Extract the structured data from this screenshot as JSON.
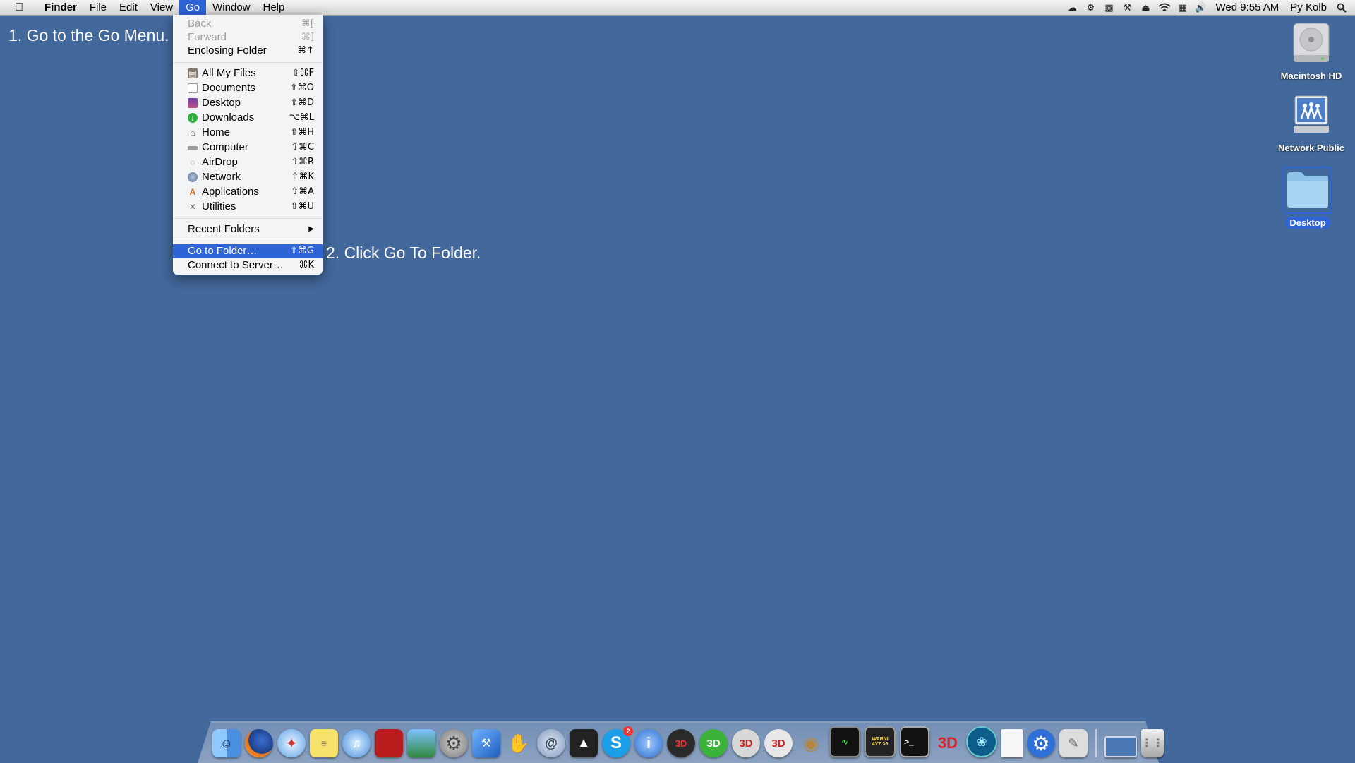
{
  "menubar": {
    "apple_icon": "apple-logo-icon",
    "app_name": "Finder",
    "menus": [
      "File",
      "Edit",
      "View",
      "Go",
      "Window",
      "Help"
    ],
    "active_menu": "Go"
  },
  "status": {
    "icons": [
      "cloud-app-icon",
      "gear-app-icon",
      "pc-app-icon",
      "tools-icon",
      "eject-icon",
      "wifi-icon",
      "input-menu-icon",
      "volume-icon"
    ],
    "datetime": "Wed 9:55 AM",
    "user": "Py Kolb",
    "search_icon": "spotlight-icon"
  },
  "go_menu": {
    "back": {
      "label": "Back",
      "shortcut": "⌘["
    },
    "forward": {
      "label": "Forward",
      "shortcut": "⌘]"
    },
    "enclosing": {
      "label": "Enclosing Folder",
      "shortcut": "⌘↑"
    },
    "places": [
      {
        "label": "All My Files",
        "shortcut": "⇧⌘F",
        "icon": "all-files-icon"
      },
      {
        "label": "Documents",
        "shortcut": "⇧⌘O",
        "icon": "documents-icon"
      },
      {
        "label": "Desktop",
        "shortcut": "⇧⌘D",
        "icon": "desktop-icon"
      },
      {
        "label": "Downloads",
        "shortcut": "⌥⌘L",
        "icon": "downloads-icon"
      },
      {
        "label": "Home",
        "shortcut": "⇧⌘H",
        "icon": "home-icon"
      },
      {
        "label": "Computer",
        "shortcut": "⇧⌘C",
        "icon": "computer-icon"
      },
      {
        "label": "AirDrop",
        "shortcut": "⇧⌘R",
        "icon": "airdrop-icon"
      },
      {
        "label": "Network",
        "shortcut": "⇧⌘K",
        "icon": "network-icon"
      },
      {
        "label": "Applications",
        "shortcut": "⇧⌘A",
        "icon": "applications-icon"
      },
      {
        "label": "Utilities",
        "shortcut": "⇧⌘U",
        "icon": "utilities-icon"
      }
    ],
    "recent": {
      "label": "Recent Folders",
      "arrow": "▶"
    },
    "goto": {
      "label": "Go to Folder…",
      "shortcut": "⇧⌘G"
    },
    "connect": {
      "label": "Connect to Server…",
      "shortcut": "⌘K"
    }
  },
  "annotations": {
    "step1": "1. Go to the Go Menu.",
    "step2": "2. Click Go To Folder."
  },
  "desktop_icons": [
    {
      "label": "Macintosh HD",
      "icon": "hard-drive-icon"
    },
    {
      "label": "Network Public",
      "icon": "network-share-icon"
    },
    {
      "label": "Desktop",
      "icon": "folder-icon",
      "selected": true
    }
  ],
  "dock": {
    "items": [
      "finder-icon",
      "firefox-icon",
      "safari-icon",
      "stickies-icon",
      "itunes-icon",
      "photo-booth-icon",
      "iphoto-icon",
      "system-preferences-icon",
      "xcode-icon",
      "gesture-app-icon",
      "mail-app-icon",
      "unity-icon",
      "skype-icon",
      "info-app-icon",
      "3d-app-icon",
      "3ds-5-icon",
      "3ds-6-icon",
      "3ds-7-icon",
      "monkey-app-icon",
      "activity-monitor-icon",
      "console-icon",
      "terminal-icon",
      "3ds-8-icon",
      "tree-app-icon",
      "text-document-icon",
      "settings-gear-icon",
      "script-editor-icon",
      "desktop-stack-icon",
      "trash-icon"
    ],
    "skype_badge": "2",
    "console_text": "WARNI",
    "console_time": "4Y7:36"
  },
  "colors": {
    "desktop": "#43689b",
    "highlight": "#2f64d6"
  }
}
